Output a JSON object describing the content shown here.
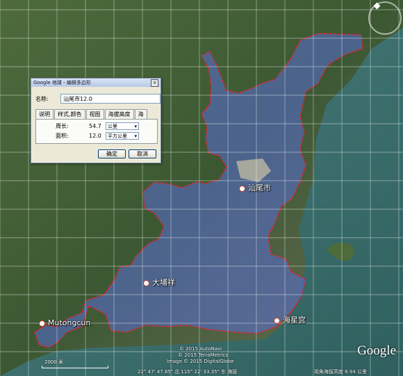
{
  "dialog": {
    "title": "Google 地球 - 编辑多边形",
    "close_label": "×",
    "name_label": "名称:",
    "name_value": "汕尾市12.0",
    "tabs": [
      "说明",
      "样式,颜色",
      "视图",
      "海拔高度",
      "海"
    ],
    "perimeter_label": "周长:",
    "perimeter_value": "54.7",
    "perimeter_unit": "公里",
    "area_label": "面积:",
    "area_value": "12.0",
    "area_unit": "平方公里",
    "ok_label": "确定",
    "cancel_label": "取消"
  },
  "places": {
    "shanwei": "汕尾市",
    "dazhengxiang": "大埔祥",
    "haiyonggong": "海星宫",
    "mutong": "Mutongcun"
  },
  "footer": {
    "copyright1": "© 2015 AutoNavi",
    "copyright2": "© 2015 TerraMetrics",
    "copyright3": "Image © 2015 DigitalGlobe",
    "coords": "22° 47' 47.85\" 北   115° 22' 33.35\" 东  海拔",
    "view_alt": "视角海拔高度    6.94 公里",
    "scale_label": "2000 米",
    "logo": "Google"
  },
  "colors": {
    "polygon_fill": "#5a6dd6",
    "polygon_stroke": "#e8202a",
    "sea": "#3f7573",
    "land": "#3e5a33",
    "grid": "#ffffff"
  }
}
